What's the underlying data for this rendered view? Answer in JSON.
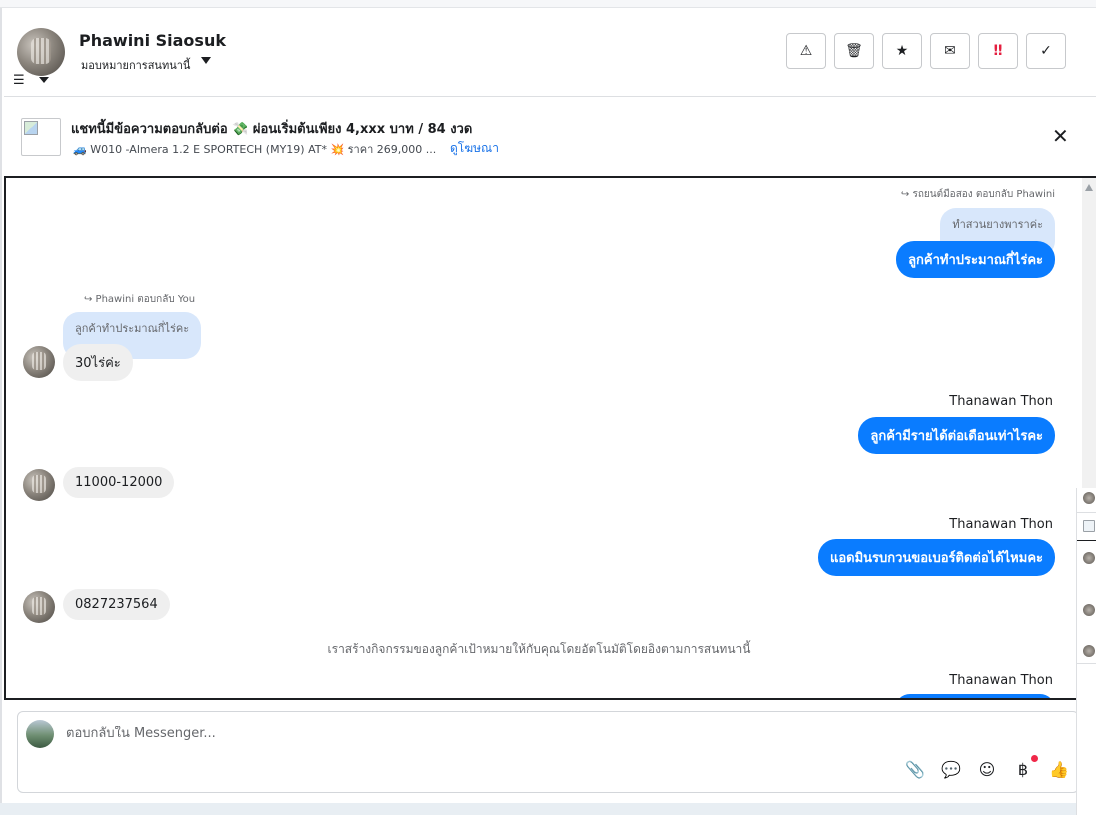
{
  "header": {
    "contact_name": "Phawini Siaosuk",
    "assign_label": "มอบหมายการสนทนานี้",
    "toolbar": [
      {
        "name": "report-button",
        "icon": "warning-icon",
        "glyph": "⚠"
      },
      {
        "name": "delete-button",
        "icon": "trash-icon",
        "glyph": "🗑"
      },
      {
        "name": "star-button",
        "icon": "star-icon",
        "glyph": "★"
      },
      {
        "name": "mail-button",
        "icon": "envelope-icon",
        "glyph": "✉"
      },
      {
        "name": "priority-button",
        "icon": "double-exclamation-icon",
        "glyph": "‼"
      },
      {
        "name": "done-button",
        "icon": "check-icon",
        "glyph": "✓"
      }
    ]
  },
  "ad": {
    "title": "แชทนี้มีข้อความตอบกลับต่อ 💸 ผ่อนเริ่มต้นเพียง 4,xxx บาท / 84 งวด",
    "subtitle": "🚙 W010 -Almera 1.2 E SPORTECH (MY19) AT* 💥 ราคา 269,000 ...",
    "link": "ดูโฆษณา"
  },
  "chat": {
    "reply1_meta": "↪ รถยนต์มือสอง ตอบกลับ Phawini",
    "reply1_quote": "ทำสวนยางพาราค่ะ",
    "reply1_text": "ลูกค้าทำประมาณกี่ไร่คะ",
    "reply2_meta": "↪ Phawini ตอบกลับ You",
    "reply2_quote": "ลูกค้าทำประมาณกี่ไร่คะ",
    "reply2_text": "30ไร่ค่ะ",
    "sender1": "Thanawan Thon",
    "out2_text": "ลูกค้ามีรายได้ต่อเดือนเท่าไรคะ",
    "in2_text": "11000-12000",
    "sender2": "Thanawan Thon",
    "out3_text": "แอดมินรบกวนขอเบอร์ติดต่อได้ไหมคะ",
    "in3_text": "0827237564",
    "system_note": "เราสร้างกิจกรรมของลูกค้าเป้าหมายให้กับคุณโดยอัตโนมัติโดยอิงตามการสนทนานี้",
    "sender3": "Thanawan Thon"
  },
  "composer": {
    "placeholder": "ตอบกลับใน Messenger...",
    "tools": [
      {
        "name": "attach-button",
        "icon": "paperclip-icon",
        "glyph": "📎"
      },
      {
        "name": "saved-replies-button",
        "icon": "chat-bubble-icon",
        "glyph": "💬"
      },
      {
        "name": "emoji-button",
        "icon": "smiley-icon",
        "glyph": "☺"
      },
      {
        "name": "payment-button",
        "icon": "baht-icon",
        "glyph": "฿"
      },
      {
        "name": "like-button",
        "icon": "thumbs-up-icon",
        "glyph": "👍"
      }
    ]
  },
  "colors": {
    "outgoing_bubble": "#0a7cff",
    "incoming_bubble": "#efefef",
    "quote_bubble": "#d8e7fb",
    "link": "#1a73e8",
    "alert": "#e41e3f"
  }
}
